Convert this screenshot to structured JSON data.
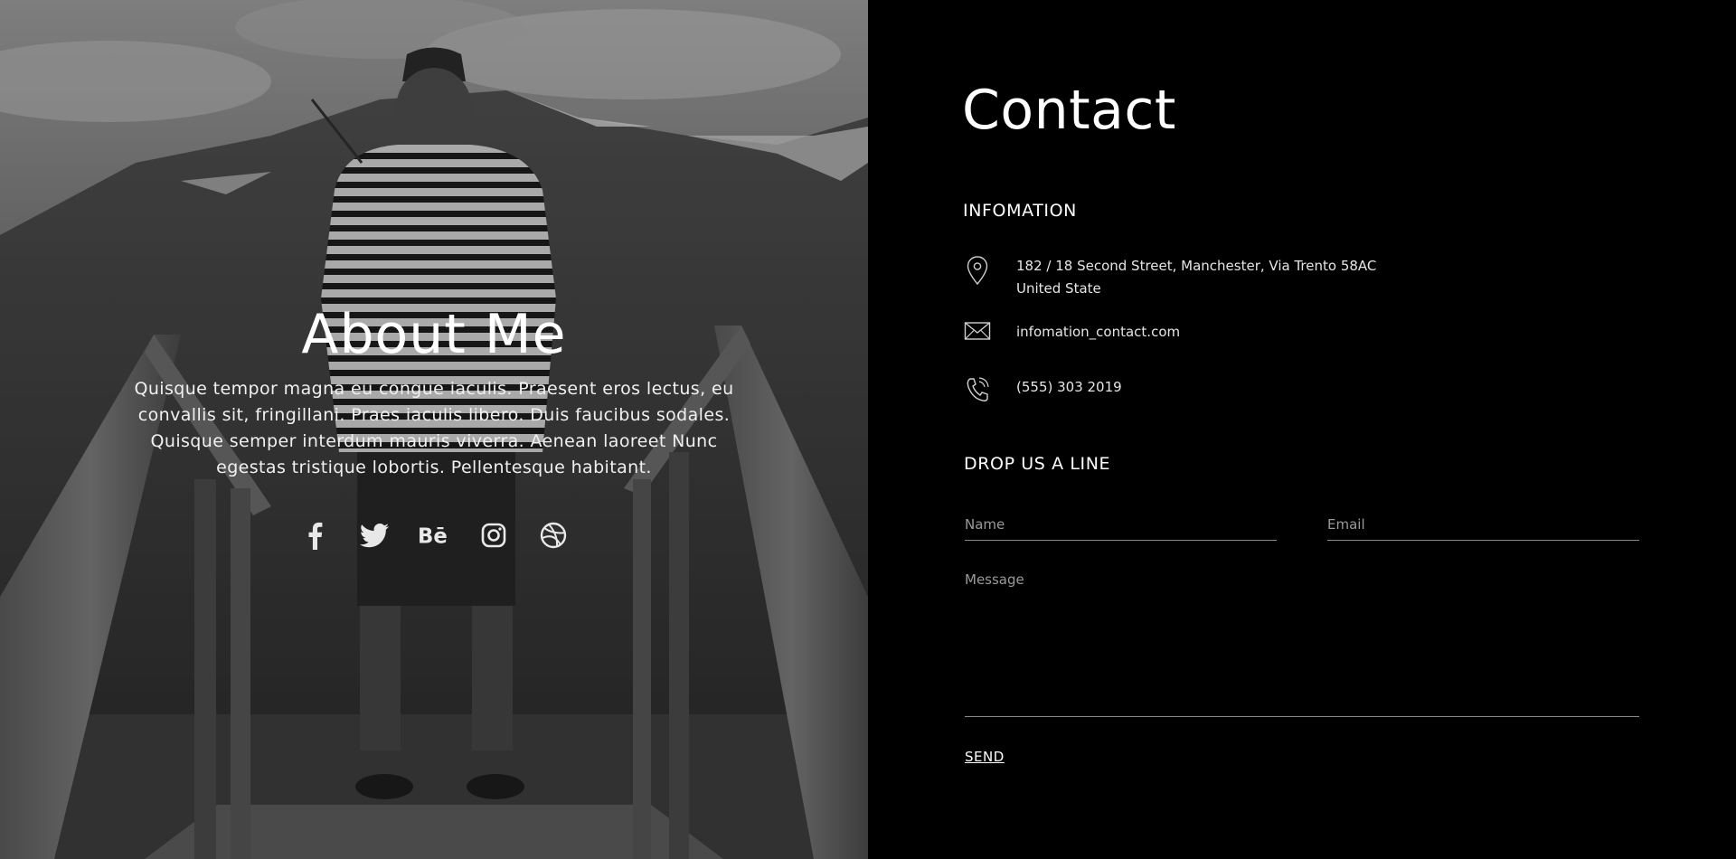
{
  "about": {
    "title": "About Me",
    "text": "Quisque tempor magna eu congue iaculis. Praesent eros lectus, eu convallis sit, fringillani. Praes iaculis libero. Duis faucibus sodales. Quisque semper interdum mauris viverra. Aenean laoreet Nunc egestas tristique lobortis. Pellentesque habitant.",
    "socials": [
      {
        "icon": "facebook-icon"
      },
      {
        "icon": "twitter-icon"
      },
      {
        "icon": "behance-icon"
      },
      {
        "icon": "instagram-icon"
      },
      {
        "icon": "dribbble-icon"
      }
    ]
  },
  "contact": {
    "title": "Contact",
    "info_heading": "INFOMATION",
    "address_line1": "182 / 18 Second Street, Manchester, Via Trento 58AC",
    "address_line2": "United State",
    "email": "infomation_contact.com",
    "phone": "(555) 303 2019",
    "form_heading": "DROP US A LINE",
    "name_placeholder": "Name",
    "email_placeholder": "Email",
    "message_placeholder": "Message",
    "send_label": "SEND"
  }
}
